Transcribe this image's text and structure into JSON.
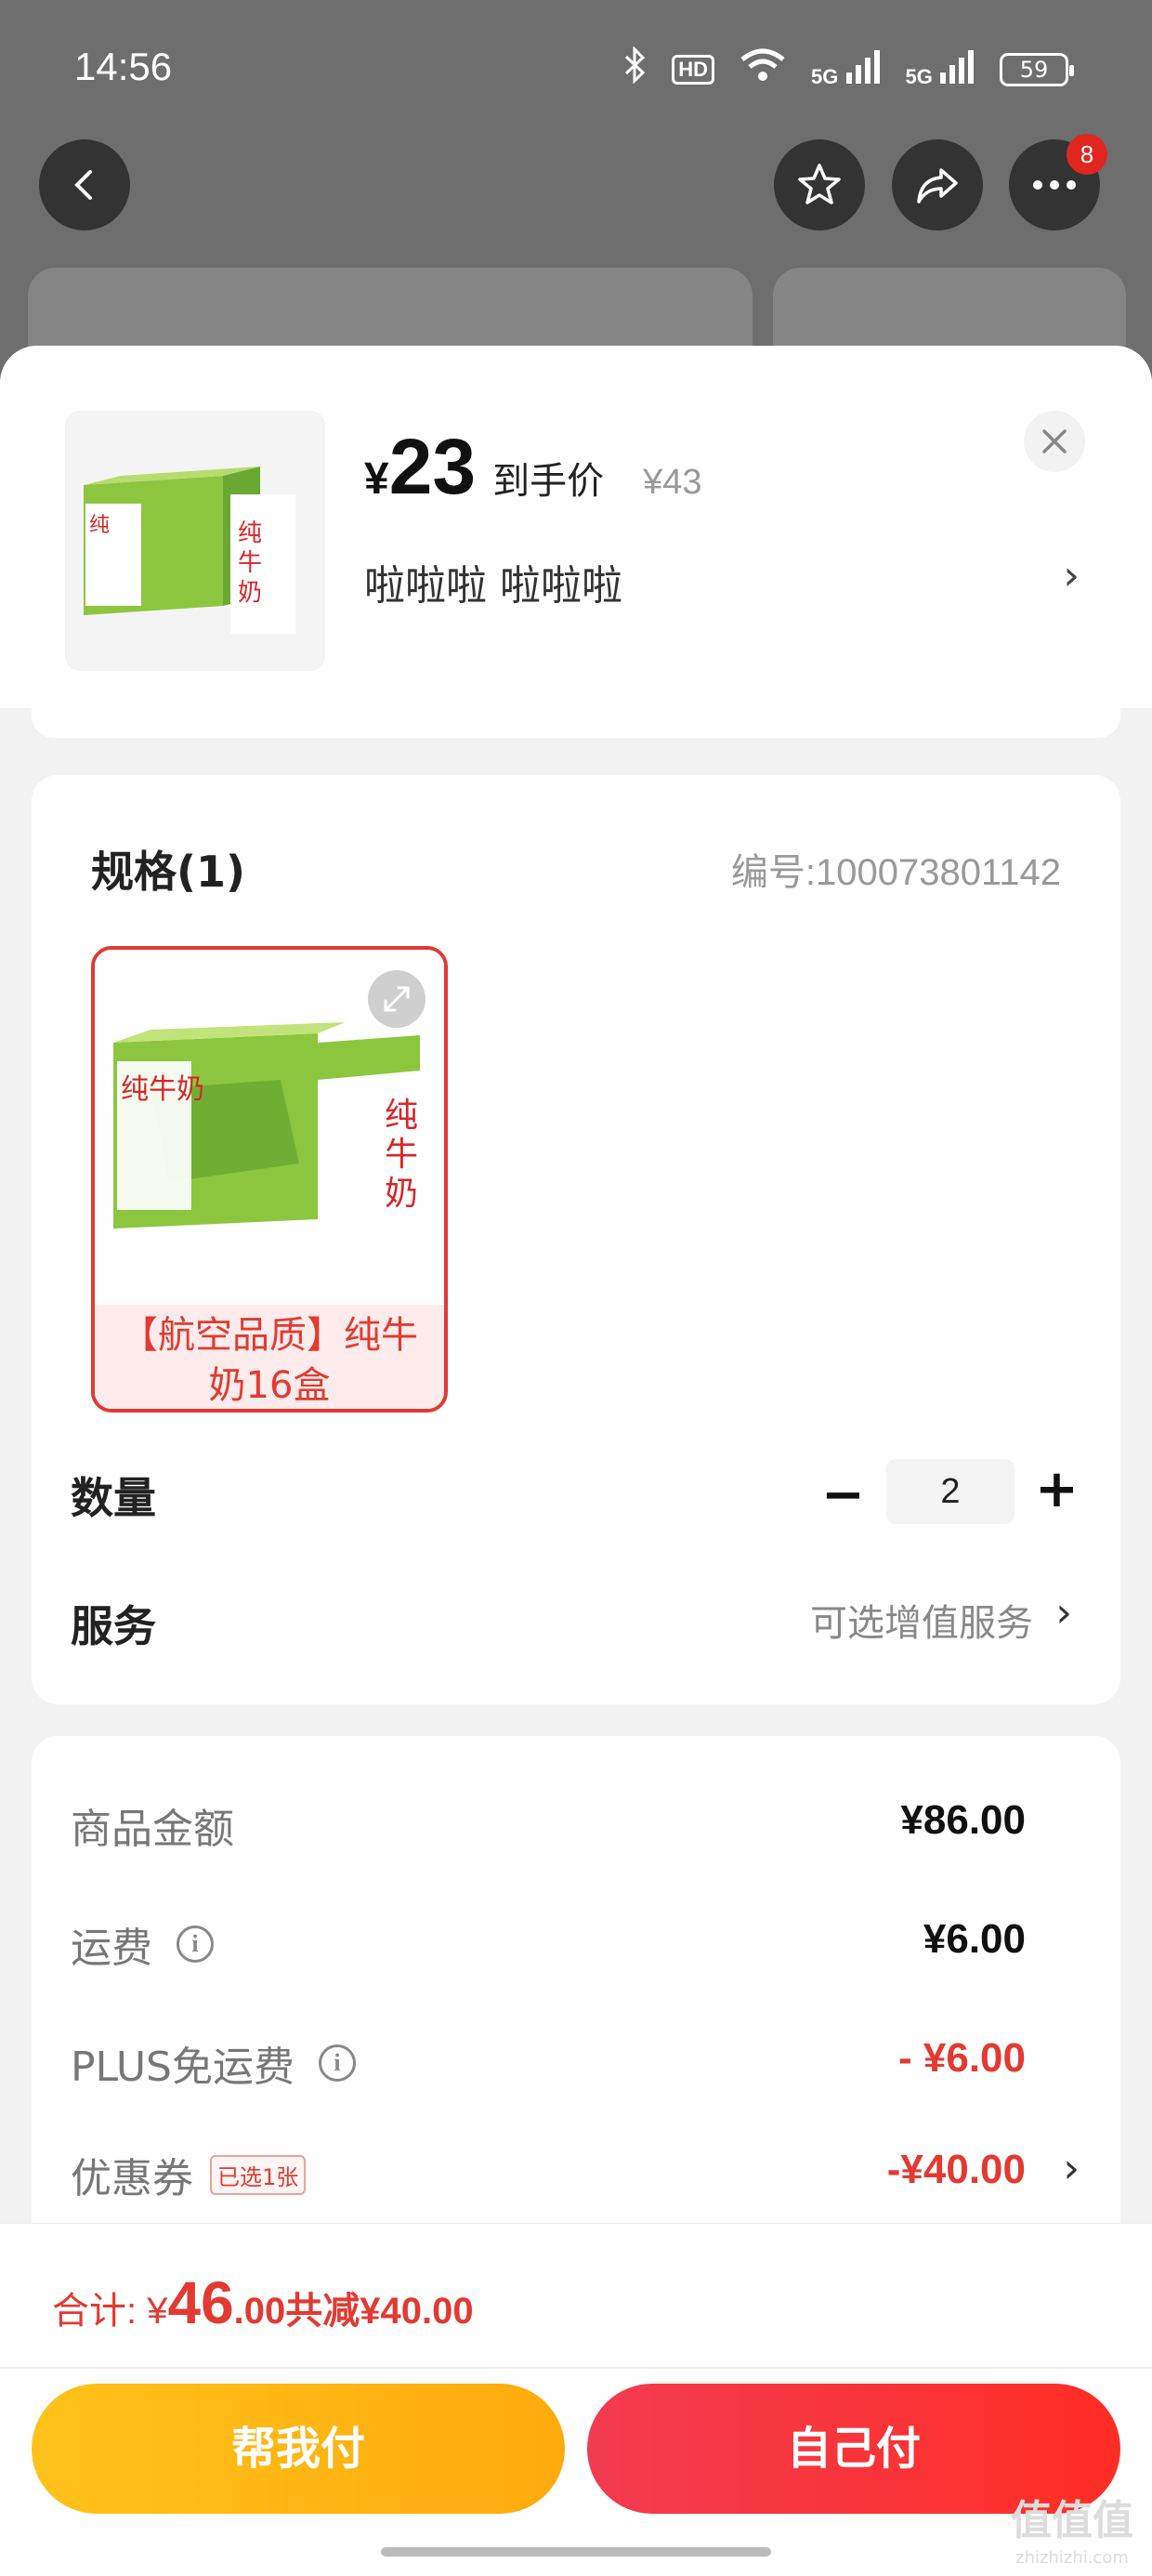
{
  "status_bar": {
    "time": "14:56",
    "hd_label": "HD",
    "net1": "5G",
    "net2": "5G",
    "battery": "59"
  },
  "nav": {
    "more_badge": "8"
  },
  "product": {
    "price_symbol": "¥",
    "price": "23",
    "price_label": "到手价",
    "original_price": "¥43",
    "subtitle": "啦啦啦  啦啦啦",
    "thumb_text": "纯牛奶"
  },
  "spec": {
    "title": "规格(1)",
    "code": "编号:100073801142",
    "item_label": "【航空品质】纯牛奶16盒",
    "item_image_text": "纯牛奶"
  },
  "quantity": {
    "label": "数量",
    "value": "2"
  },
  "service": {
    "label": "服务",
    "value": "可选增值服务"
  },
  "summary": {
    "rows": [
      {
        "label": "商品金额",
        "value": "¥86.00"
      },
      {
        "label": "运费",
        "value": "¥6.00"
      },
      {
        "label": "PLUS免运费",
        "value": "- ¥6.00"
      },
      {
        "label": "优惠券",
        "tag": "已选1张",
        "value": "-¥40.00"
      }
    ]
  },
  "bottom": {
    "total_label": "合计: ¥",
    "total_int": "46",
    "total_dec": ".00",
    "discount": " 共减¥40.00",
    "btn_help": "帮我付",
    "btn_self": "自己付",
    "watermark": "值值值",
    "watermark_sub": "zhizhizhi.com"
  },
  "colors": {
    "accent_red": "#e23a32",
    "help_button": "#ffb814",
    "self_button": "#f53540"
  }
}
